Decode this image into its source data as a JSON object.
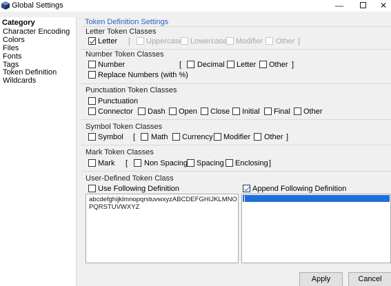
{
  "window": {
    "title": "Global Settings",
    "min": "—",
    "close": "✕"
  },
  "sidebar": {
    "title": "Category",
    "items": [
      "Character Encoding",
      "Colors",
      "Files",
      "Fonts",
      "Tags",
      "Token Definition",
      "Wildcards"
    ]
  },
  "main": {
    "heading": "Token Definition Settings",
    "letter": {
      "title": "Letter Token Classes",
      "letter": "Letter",
      "uppercase": "Uppercase",
      "lowercase": "Lowercase",
      "modifier": "Modifier",
      "other": "Other",
      "open": "[",
      "close": "]"
    },
    "number": {
      "title": "Number Token Classes",
      "number": "Number",
      "decimal": "Decimal",
      "letter": "Letter",
      "other": "Other",
      "replace": "Replace Numbers (with %)",
      "open": "[",
      "close": "]"
    },
    "punctuation": {
      "title": "Punctuation Token Classes",
      "punctuation": "Punctuation",
      "connector": "Connector",
      "dash": "Dash",
      "open": "Open",
      "close": "Close",
      "initial": "Initial",
      "final": "Final",
      "other": "Other"
    },
    "symbol": {
      "title": "Symbol Token Classes",
      "symbol": "Symbol",
      "math": "Math",
      "currency": "Currency",
      "modifier": "Modifier",
      "other": "Other",
      "open": "[",
      "close": "]"
    },
    "mark": {
      "title": "Mark Token Classes",
      "mark": "Mark",
      "nonspacing": "Non Spacing",
      "spacing": "Spacing",
      "enclosing": "Enclosing",
      "open": "[",
      "close": "]"
    },
    "user": {
      "title": "User-Defined Token Class",
      "use_following": "Use Following Definition",
      "append_following": "Append Following Definition",
      "definition_text": "abcdefghijklmnopqrstuvwxyzABCDEFGHIJKLMNOPQRSTUVWXYZ",
      "append_text": ""
    }
  },
  "buttons": {
    "apply": "Apply",
    "cancel": "Cancel"
  },
  "checked": {
    "letter": true,
    "uppercase": false,
    "lowercase": false,
    "modifier": false,
    "other": false,
    "append_following": true,
    "use_following": false
  },
  "colors": {
    "heading": "#2a63c5",
    "selection": "#1e6fd9",
    "check_blue": "#1e6ad6"
  }
}
